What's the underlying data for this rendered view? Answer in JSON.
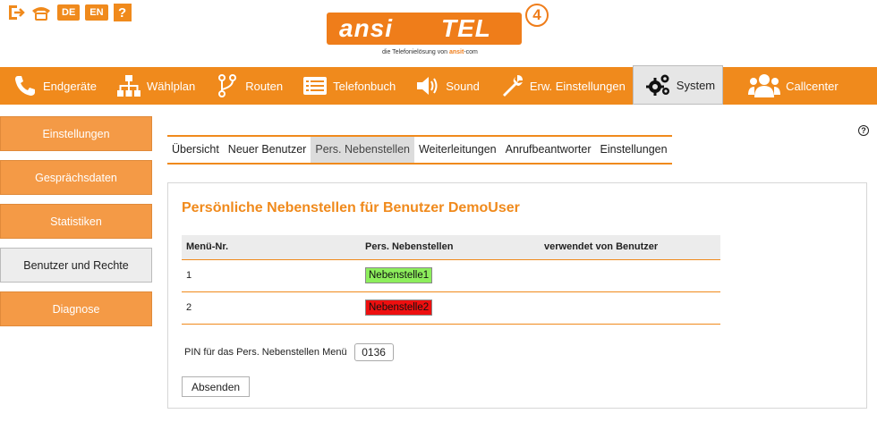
{
  "top_icons": {
    "logout_icon": "exit-icon",
    "phone_icon": "phone-icon",
    "lang_de": "DE",
    "lang_en": "EN",
    "help": "?"
  },
  "logo": {
    "word_a": "ansi",
    "word_b": "TEL",
    "version": "4",
    "tagline_prefix": "die Telefonielösung von ",
    "tagline_brand": "ansit",
    "tagline_suffix": "-com"
  },
  "navbar": {
    "items": [
      {
        "label": "Endgeräte",
        "icon": "phone-icon"
      },
      {
        "label": "Wählplan",
        "icon": "hierarchy-icon"
      },
      {
        "label": "Routen",
        "icon": "route-icon"
      },
      {
        "label": "Telefonbuch",
        "icon": "phonebook-icon"
      },
      {
        "label": "Sound",
        "icon": "speaker-icon"
      },
      {
        "label": "Erw. Einstellungen",
        "icon": "wrench-icon"
      },
      {
        "label": "System",
        "icon": "gears-icon"
      },
      {
        "label": "Callcenter",
        "icon": "users-icon"
      }
    ],
    "active": "System"
  },
  "sidebar": {
    "items": [
      {
        "label": "Einstellungen"
      },
      {
        "label": "Gesprächsdaten"
      },
      {
        "label": "Statistiken"
      },
      {
        "label": "Benutzer und Rechte"
      },
      {
        "label": "Diagnose"
      }
    ],
    "active": "Benutzer und Rechte"
  },
  "help_symbol": "?",
  "tabs": {
    "items": [
      {
        "label": "Übersicht"
      },
      {
        "label": "Neuer Benutzer"
      },
      {
        "label": "Pers. Nebenstellen"
      },
      {
        "label": "Weiterleitungen"
      },
      {
        "label": "Anrufbeantworter"
      },
      {
        "label": "Einstellungen"
      }
    ],
    "active": "Pers. Nebenstellen"
  },
  "main": {
    "title": "Persönliche Nebenstellen für Benutzer DemoUser",
    "table": {
      "headers": [
        "Menü-Nr.",
        "Pers. Nebenstellen",
        "verwendet von Benutzer"
      ],
      "rows": [
        {
          "nr": "1",
          "ext": "Nebenstelle1",
          "status_color": "#8dee5c",
          "user": ""
        },
        {
          "nr": "2",
          "ext": "Nebenstelle2",
          "status_color": "#ee0f0f",
          "user": ""
        }
      ]
    },
    "pin_label": "PIN für das Pers. Nebenstellen Menü",
    "pin_value": "0136",
    "submit_label": "Absenden"
  },
  "colors": {
    "accent": "#f08a1c",
    "sidebar_bg": "#f49a46",
    "ok": "#8dee5c",
    "error": "#ee0f0f"
  }
}
